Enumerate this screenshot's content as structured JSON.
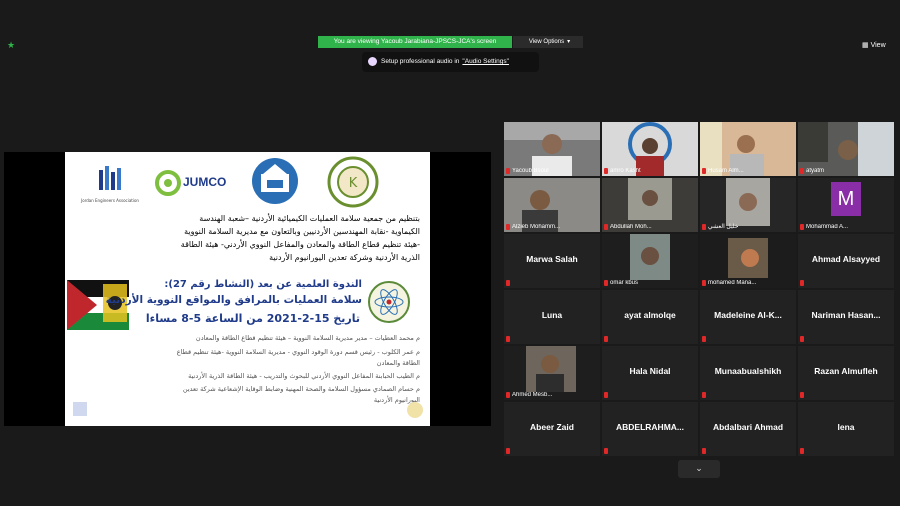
{
  "top": {
    "banner": "You are viewing Yacoub Jarabiana-JPSCS-JCA's screen",
    "view_options": "View Options",
    "view_button": "View",
    "notice_text": "Setup professional audio in",
    "notice_link": "\"Audio Settings\""
  },
  "slide": {
    "logo_jumco": "JUMCO",
    "logo_left_caption": "Jordan Engineers Association",
    "lines": [
      "بتنظيم من جمعية سلامة العمليات الكيميائية الأردنية –شعبة الهندسة",
      "الكيماوية -نقابة المهندسين الأردنيين  وبالتعاون مع مديرية السلامة النووية",
      "-هيئة تنظيم قطاع الطاقة والمعادن والمفاعل النووي الأردني- هيئة الطاقة",
      "الذرية الأردنية وشركة تعدين اليورانيوم الأردنية",
      "الندوة العلمية عن بعد (النشاط رقم 27):",
      "سلامة العمليات بالمرافق والمواقع النووية الأردنية",
      "تاريخ 15-2-2021 من الساعة 5-8 مساءا",
      "م محمد العطيات – مدير مديرية السلامة النووية – هيئة تنظيم قطاع الطاقة والمعادن",
      "م عمر الكلوب - رئيس قسم دورة الوقود النووي - مديرية السلامة النووية -هيئة تنظيم قطاع",
      "الطاقة والمعادن",
      "م الطيب الحبابنة   المفاعل النووي الأردني للبحوث والتدريب - هيئة الطاقة الذرية الأردنية",
      "م حسام الصمادي    مسؤول السلامة والصحة المهنية وضابط الوقاية الإشعاعية شركة تعدين",
      "اليورانيوم الأردنية"
    ]
  },
  "participants": [
    {
      "name": "Yacoub Bsoul",
      "kind": "video"
    },
    {
      "name": "amro Kasht",
      "kind": "video"
    },
    {
      "name": "Husam Alm...",
      "kind": "video"
    },
    {
      "name": "atyatm",
      "kind": "video"
    },
    {
      "name": "Alzieb Mohamm...",
      "kind": "video"
    },
    {
      "name": "Abdullah Moh...",
      "kind": "video"
    },
    {
      "name": "خليل العشي",
      "kind": "video"
    },
    {
      "name": "Mohammad A...",
      "kind": "avatar",
      "initial": "M"
    },
    {
      "name": "Marwa Salah",
      "kind": "name"
    },
    {
      "name": "omar kbus",
      "kind": "video"
    },
    {
      "name": "mohamed Mana...",
      "kind": "video",
      "active": true
    },
    {
      "name": "Ahmad Alsayyed",
      "kind": "name"
    },
    {
      "name": "Luna",
      "kind": "name"
    },
    {
      "name": "ayat almolqe",
      "kind": "name"
    },
    {
      "name": "Madeleine  Al-K...",
      "kind": "name"
    },
    {
      "name": "Nariman  Hasan...",
      "kind": "name"
    },
    {
      "name": "Ahmed Mesb...",
      "kind": "video"
    },
    {
      "name": "Hala Nidal",
      "kind": "name"
    },
    {
      "name": "Munaabualshikh",
      "kind": "name"
    },
    {
      "name": "Razan Almufleh",
      "kind": "name"
    },
    {
      "name": "Abeer Zaid",
      "kind": "name"
    },
    {
      "name": "ABDELRAHMA...",
      "kind": "name"
    },
    {
      "name": "Abdalbari Ahmad",
      "kind": "name"
    },
    {
      "name": "lena",
      "kind": "name"
    }
  ],
  "colors": {
    "banner": "#2fb34a",
    "mic_muted": "#e02828",
    "active_speaker": "#d8e64a",
    "avatar_bg": "#8a2ea8",
    "slide_blue": "#1f3b8a",
    "slide_red": "#c0272d"
  },
  "icons": {
    "shield": "shield-icon",
    "grid": "grid-icon",
    "chevron": "chevron-down-icon",
    "mic": "mic-muted-icon"
  }
}
